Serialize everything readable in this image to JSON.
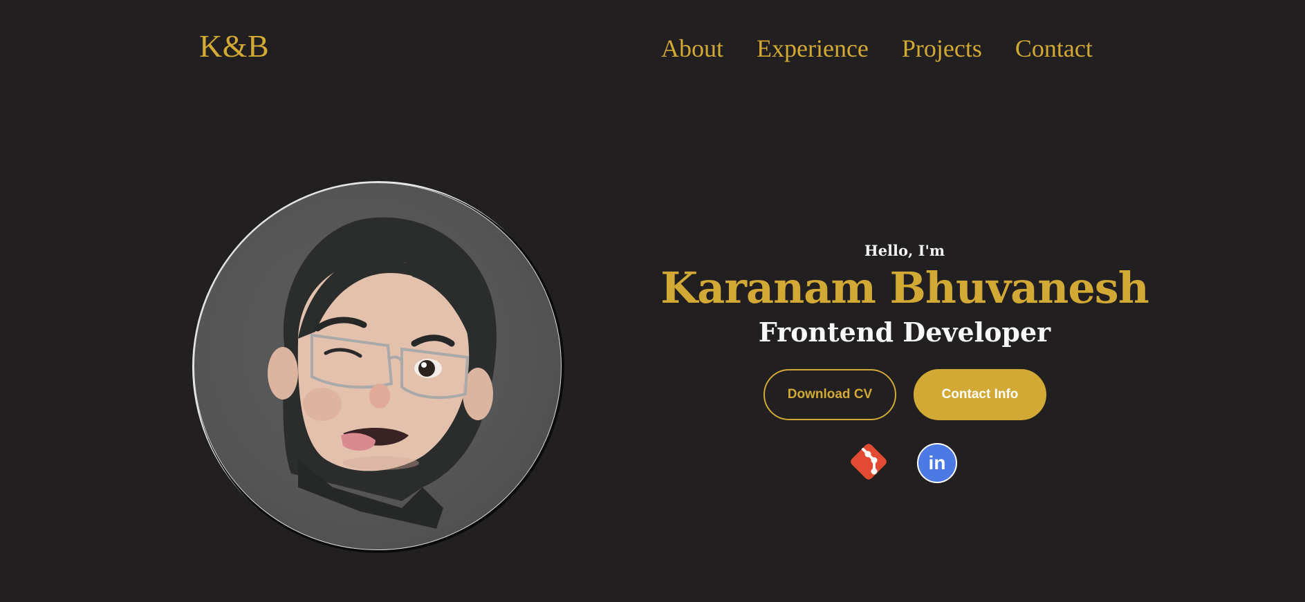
{
  "nav": {
    "logo": "K&B",
    "links": [
      "About",
      "Experience",
      "Projects",
      "Contact"
    ]
  },
  "hero": {
    "greeting": "Hello, I'm",
    "name": "Karanam Bhuvanesh",
    "role": "Frontend Developer",
    "download_cv_label": "Download CV",
    "contact_info_label": "Contact Info"
  },
  "social": {
    "git_icon": "git-icon",
    "linkedin_icon": "linkedin-icon",
    "linkedin_glyph": "in"
  },
  "colors": {
    "background": "#221f20",
    "accent": "#d3a935",
    "text_light": "#f7f7f7",
    "git": "#e24b32",
    "linkedin": "#4c79e3"
  }
}
